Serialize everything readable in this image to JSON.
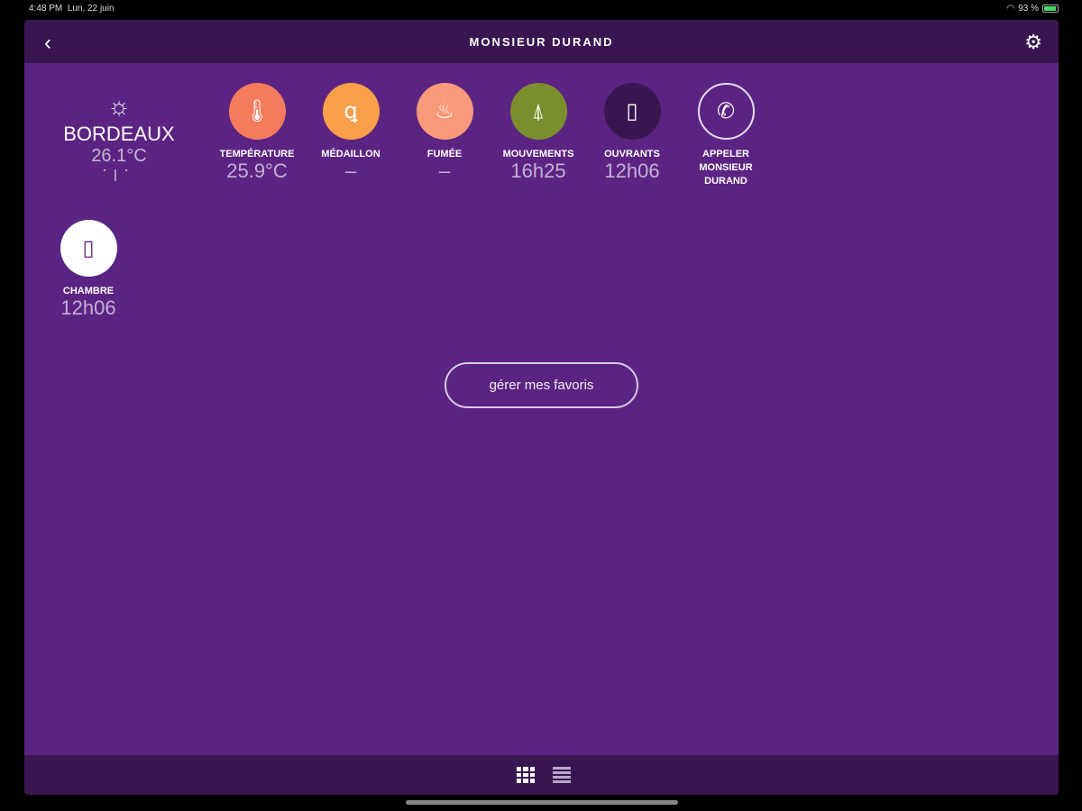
{
  "status": {
    "time": "4:48 PM",
    "date": "Lun. 22 juin",
    "battery": "93 %"
  },
  "header": {
    "title": "MONSIEUR DURAND"
  },
  "weather": {
    "city": "BORDEAUX",
    "temp": "26.1°C"
  },
  "tiles": [
    {
      "label": "TEMPÉRATURE",
      "value": "25.9°C",
      "color": "#f47b5d",
      "icon": "thermometer-icon"
    },
    {
      "label": "MÉDAILLON",
      "value": "–",
      "color": "#f7a049",
      "icon": "pendant-icon"
    },
    {
      "label": "FUMÉE",
      "value": "–",
      "color": "#f8997a",
      "icon": "flame-icon"
    },
    {
      "label": "MOUVEMENTS",
      "value": "16h25",
      "color": "#7a8e2c",
      "icon": "motion-sensor-icon"
    },
    {
      "label": "OUVRANTS",
      "value": "12h06",
      "color": "#3a1651",
      "icon": "door-icon"
    },
    {
      "label": "APPELER MONSIEUR DURAND",
      "value": "",
      "color": "transparent",
      "icon": "phone-icon"
    },
    {
      "label": "CHAMBRE",
      "value": "12h06",
      "color": "#ffffff",
      "icon": "door-icon"
    }
  ],
  "fav_button": "gérer mes favoris"
}
